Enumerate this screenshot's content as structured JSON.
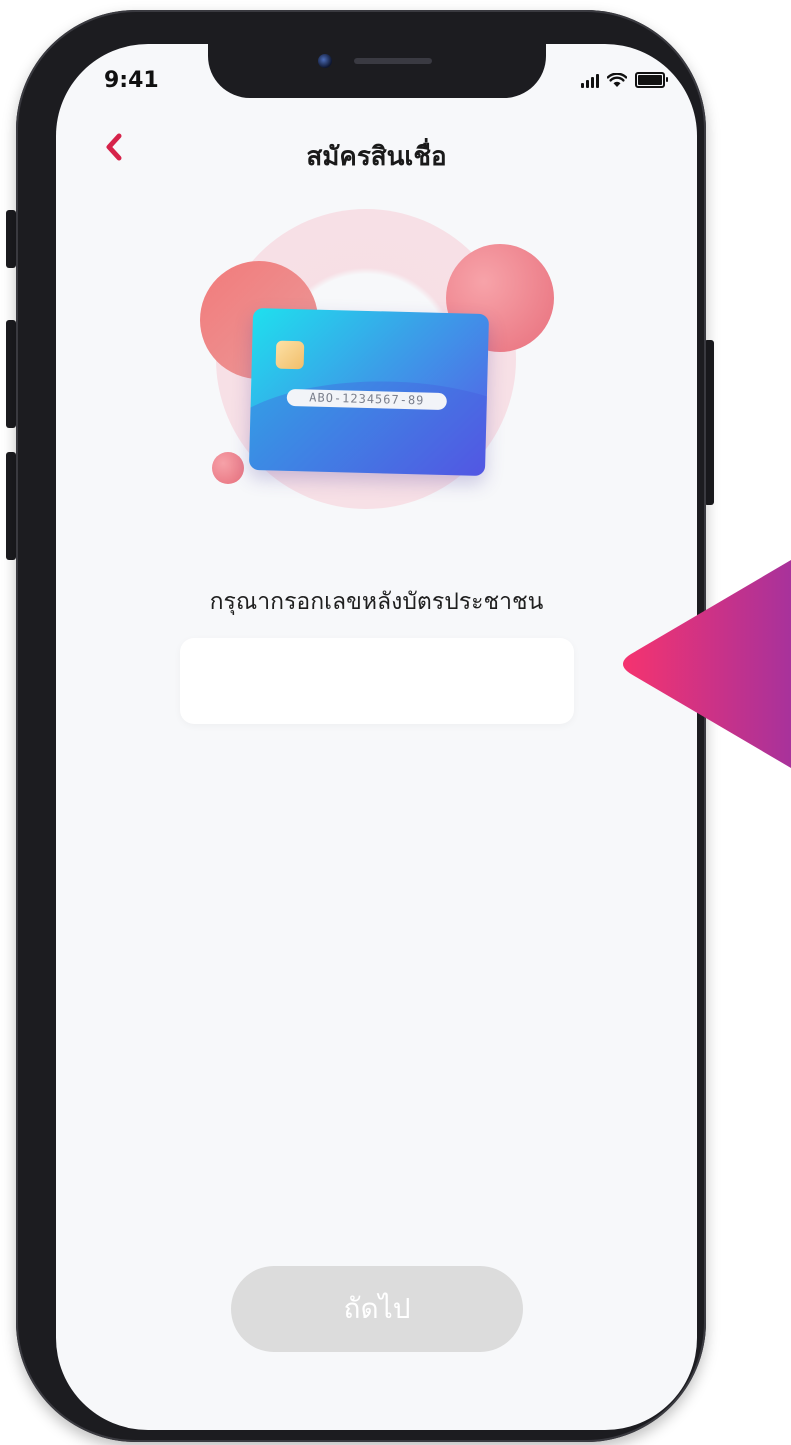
{
  "status_bar": {
    "time": "9:41"
  },
  "nav": {
    "title": "สมัครสินเชื่อ"
  },
  "illustration": {
    "card_number": "ABO-1234567-89"
  },
  "form": {
    "prompt": "กรุณากรอกเลขหลังบัตรประชาชน",
    "id_input_value": "",
    "id_input_placeholder": ""
  },
  "actions": {
    "next_label": "ถัดไป"
  },
  "colors": {
    "accent": "#d6234a",
    "disabled_button": "#dcdcdc",
    "pointer_start": "#f5336f",
    "pointer_end": "#a8329b"
  }
}
